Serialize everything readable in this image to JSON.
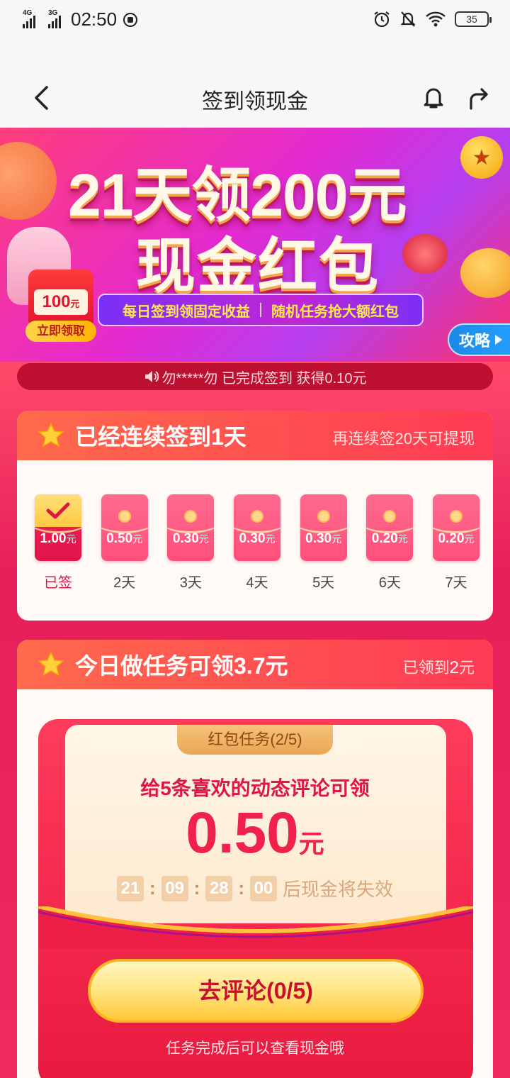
{
  "status_bar": {
    "network1": "4G",
    "network2": "3G",
    "time": "02:50",
    "battery": "35"
  },
  "nav": {
    "title": "签到领现金"
  },
  "banner": {
    "title_line1": "21天领200元",
    "title_line2": "现金红包",
    "ribbon_left": "每日签到领固定收益",
    "ribbon_right": "随机任务抢大额红包",
    "redpack_amount": "100",
    "redpack_unit": "元",
    "claim_button": "立即领取",
    "strategy_button": "攻略"
  },
  "notice": {
    "text": "勿*****勿 已完成签到 获得0.10元"
  },
  "signin_card": {
    "title": "已经连续签到1天",
    "hint": "再连续签20天可提现",
    "days": [
      {
        "value": "1.00",
        "unit": "元",
        "label": "已签",
        "signed": true
      },
      {
        "value": "0.50",
        "unit": "元",
        "label": "2天",
        "signed": false
      },
      {
        "value": "0.30",
        "unit": "元",
        "label": "3天",
        "signed": false
      },
      {
        "value": "0.30",
        "unit": "元",
        "label": "4天",
        "signed": false
      },
      {
        "value": "0.30",
        "unit": "元",
        "label": "5天",
        "signed": false
      },
      {
        "value": "0.20",
        "unit": "元",
        "label": "6天",
        "signed": false
      },
      {
        "value": "0.20",
        "unit": "元",
        "label": "7天",
        "signed": false
      }
    ]
  },
  "task_card": {
    "title": "今日做任务可领3.7元",
    "received_prefix": "已领到",
    "received_amount": "2",
    "received_unit": "元",
    "task_tag": "红包任务(2/5)",
    "task_desc": "给5条喜欢的动态评论可领",
    "task_amount": "0.50",
    "task_unit": "元",
    "timer": {
      "h": "21",
      "m": "09",
      "s": "28",
      "ms": "00",
      "suffix": "后现金将失效"
    },
    "action_button": "去评论(0/5)",
    "hint": "任务完成后可以查看现金哦"
  },
  "colors": {
    "accent": "#f0214a",
    "banner_gradient_start": "#ff3d7a",
    "banner_gradient_end": "#b53ef0",
    "card_header": "#ff4a55",
    "gold": "#ffc83a"
  }
}
